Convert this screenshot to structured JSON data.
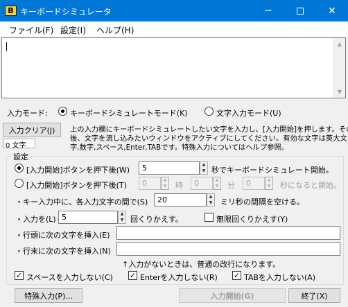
{
  "window": {
    "title": "キーボードシミュレータ",
    "app_icon": "B"
  },
  "menu": [
    "ファイル(F)",
    "設定(I)",
    "ヘルプ(H)"
  ],
  "mode": {
    "label": "入力モード:",
    "option1": "キーボードシミュレートモード(K)",
    "option2": "文字入力モード(U)"
  },
  "copy_button": "入力クリア(J)",
  "char_count": "0 文字",
  "instructions": [
    "上の入力欄にキーボードシミュレートしたい文字を入力し、[入力開始]を押します。その",
    "後、文字を流し込みたいウィンドウをアクティブにしてください。有効な文字は英大文",
    "字,数字,スペース,Enter,TABです。特殊入力についてはヘルプ参照。"
  ],
  "settings": {
    "title": "設定",
    "row1": {
      "label": "[入力開始]ボタンを押下後(W)",
      "value": "5",
      "suffix": "秒でキーボードシミュレート開始。"
    },
    "row2": {
      "label": "[入力開始]ボタンを押下後(T)",
      "h": "0",
      "h_unit": "時",
      "m": "0",
      "m_unit": "分",
      "s": "0",
      "suffix": "秒になると開始。"
    },
    "row3": {
      "label": "・キー入力中に、各入力文字の間で(S)",
      "value": "20",
      "suffix": "ミリ秒の間隔を空ける。"
    },
    "row4": {
      "label": "・入力を(L)",
      "value": "5",
      "suffix": "回くりかえす。",
      "infinite": "無限回くりかえす(Y)"
    },
    "row5": {
      "label": "・行頭に次の文字を挿入(E)",
      "value": ""
    },
    "row6": {
      "label": "・行末に次の文字を挿入(N)",
      "value": ""
    },
    "note": "↑入力がないときは、普通の改行になります。",
    "checks": [
      "スペースを入力しない(C)",
      "Enterを入力しない(R)",
      "TABを入力しない(A)"
    ]
  },
  "buttons": {
    "special": "特殊入力(P)...",
    "start": "入力開始(G)",
    "exit": "終了(X)"
  }
}
